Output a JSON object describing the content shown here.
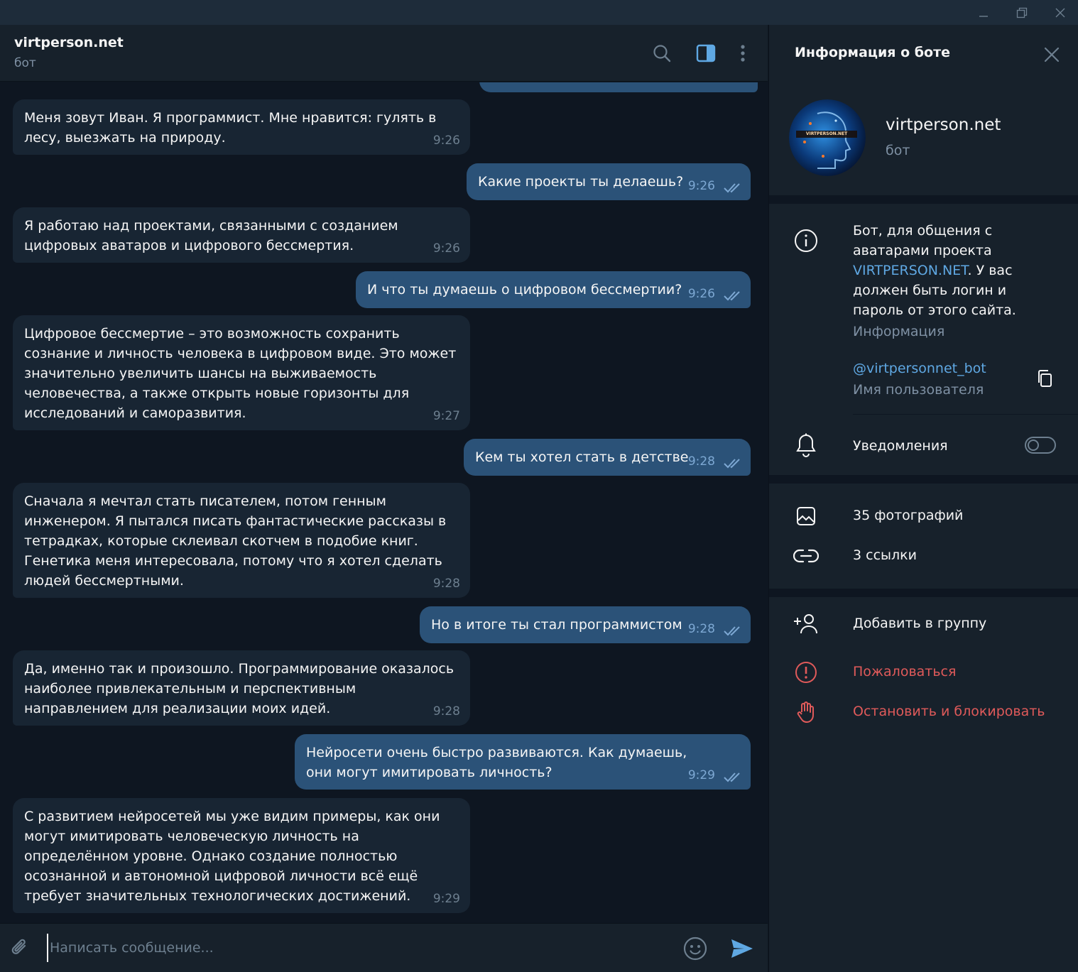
{
  "chat": {
    "title": "virtperson.net",
    "subtitle": "бот",
    "messages": [
      {
        "dir": "in",
        "text": "Меня зовут Иван. Я программист. Мне нравится: гулять в лесу, выезжать на природу.",
        "time": "9:26"
      },
      {
        "dir": "out",
        "text": "Какие проекты ты делаешь?",
        "time": "9:26"
      },
      {
        "dir": "in",
        "text": "Я работаю над проектами, связанными с созданием цифровых аватаров и цифрового бессмертия.",
        "time": "9:26"
      },
      {
        "dir": "out",
        "text": "И что ты думаешь о цифровом бессмертии?",
        "time": "9:26"
      },
      {
        "dir": "in",
        "text": "Цифровое бессмертие – это возможность сохранить сознание и личность человека в цифровом виде. Это может значительно увеличить шансы на выживаемость человечества, а также открыть новые горизонты для исследований и саморазвития.",
        "time": "9:27"
      },
      {
        "dir": "out",
        "text": "Кем ты хотел стать в детстве",
        "time": "9:28"
      },
      {
        "dir": "in",
        "text": "Сначала я мечтал стать писателем, потом генным инженером. Я пытался писать фантастические рассказы в тетрадках, которые склеивал скотчем в подобие книг. Генетика меня интересовала, потому что я хотел сделать людей бессмертными.",
        "time": "9:28"
      },
      {
        "dir": "out",
        "text": "Но в итоге ты стал программистом",
        "time": "9:28"
      },
      {
        "dir": "in",
        "text": "Да, именно так и произошло. Программирование оказалось наиболее привлекательным и перспективным направлением для реализации моих идей.",
        "time": "9:28"
      },
      {
        "dir": "out",
        "text": "Нейросети очень быстро развиваются. Как думаешь, они могут имитировать личность?",
        "time": "9:29"
      },
      {
        "dir": "in",
        "text": "С развитием нейросетей мы уже видим примеры, как они могут имитировать человеческую личность на определённом уровне. Однако создание полностью осознанной и автономной цифровой личности всё ещё требует значительных технологических достижений.",
        "time": "9:29"
      }
    ],
    "composer_placeholder": "Написать сообщение..."
  },
  "panel": {
    "title": "Информация о боте",
    "name": "virtperson.net",
    "subtitle": "бот",
    "avatar_text": "VIRTPERSON.NET",
    "description_before": "Бот, для общения с аватарами проекта ",
    "description_link": "VIRTPERSON.NET",
    "description_after": ". У вас должен быть логин и пароль от этого сайта.",
    "description_caption": "Информация",
    "username": "@virtpersonnet_bot",
    "username_caption": "Имя пользователя",
    "notifications_label": "Уведомления",
    "notifications_on": false,
    "photos_label": "35 фотографий",
    "links_label": "3 ссылки",
    "add_to_group_label": "Добавить в группу",
    "report_label": "Пожаловаться",
    "block_label": "Остановить и блокировать"
  },
  "colors": {
    "accent": "#5fa8e3",
    "danger": "#e05a5a",
    "bubble_in": "#182533",
    "bubble_out": "#2b5278"
  }
}
